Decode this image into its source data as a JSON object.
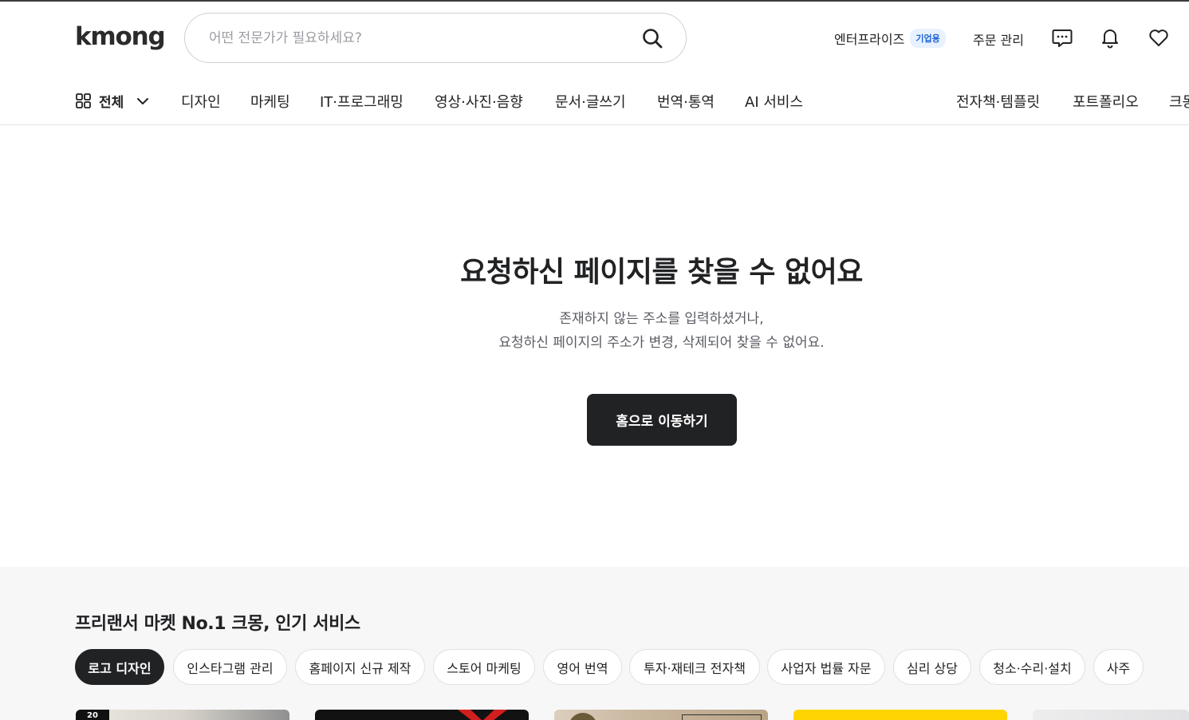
{
  "brand": {
    "logo_text": "kmong"
  },
  "search": {
    "placeholder": "어떤 전문가가 필요하세요?"
  },
  "header": {
    "enterprise_label": "엔터프라이즈",
    "enterprise_badge": "기업용",
    "orders_label": "주문 관리",
    "icons": [
      "chat-icon",
      "bell-icon",
      "heart-icon"
    ]
  },
  "nav": {
    "all_label": "전체",
    "categories": [
      "디자인",
      "마케팅",
      "IT·프로그래밍",
      "영상·사진·음향",
      "문서·글쓰기",
      "번역·통역",
      "AI 서비스"
    ],
    "right_categories": [
      "전자책·템플릿",
      "포트폴리오",
      "크몽"
    ]
  },
  "error": {
    "title": "요청하신 페이지를 찾을 수 없어요",
    "line1": "존재하지 않는 주소를 입력하셨거나,",
    "line2": "요청하신 페이지의 주소가 변경, 삭제되어 찾을 수 없어요.",
    "button": "홈으로 이동하기"
  },
  "popular": {
    "title": "프리랜서 마켓 No.1 크몽, 인기 서비스",
    "chips": [
      "로고 디자인",
      "인스타그램 관리",
      "홈페이지 신규 제작",
      "스토어 마케팅",
      "영어 번역",
      "투자·재테크 전자책",
      "사업자 법률 자문",
      "심리 상당",
      "청소·수리·설치",
      "사주"
    ],
    "active_chip": "로고 디자인",
    "first_card_badge": "20"
  },
  "colors": {
    "primary_dark": "#212224",
    "badge_blue": "#1e63d6",
    "section_bg": "#f7f7f8",
    "yellow_card": "#ffd400"
  }
}
